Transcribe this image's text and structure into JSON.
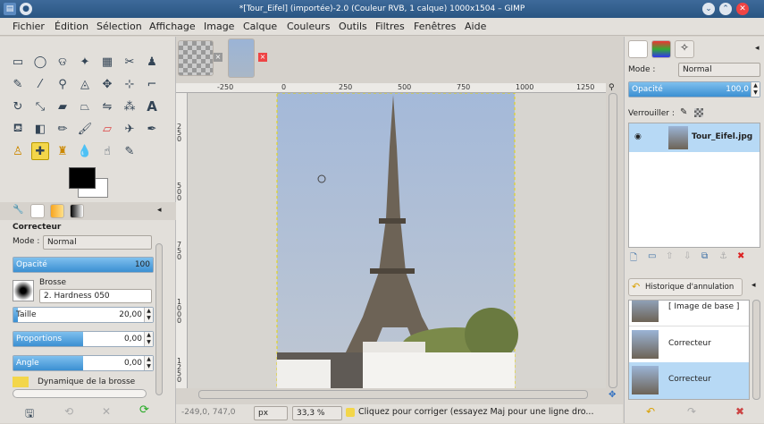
{
  "window": {
    "title": "*[Tour_Eifel] (importée)-2.0 (Couleur RVB, 1 calque) 1000x1504 – GIMP"
  },
  "menu": [
    "Fichier",
    "Édition",
    "Sélection",
    "Affichage",
    "Image",
    "Calque",
    "Couleurs",
    "Outils",
    "Filtres",
    "Fenêtres",
    "Aide"
  ],
  "toolbox": {
    "tools": [
      "rect-select",
      "ellipse-select",
      "free-select",
      "fuzzy-select",
      "color-select",
      "scissors",
      "foreground-select",
      "paths",
      "color-picker",
      "zoom",
      "measure",
      "move",
      "align",
      "crop",
      "rotate",
      "scale",
      "shear",
      "perspective",
      "flip",
      "text",
      "bucket-fill",
      "blend",
      "pencil",
      "paintbrush",
      "eraser",
      "airbrush",
      "ink",
      "clone",
      "heal",
      "perspective-clone",
      "blur",
      "smudge",
      "dodge-burn"
    ],
    "options_title": "Correcteur",
    "mode_label": "Mode :",
    "mode_value": "Normal",
    "opacity_label": "Opacité",
    "opacity_value": "100",
    "brush_label": "Brosse",
    "brush_value": "2. Hardness 050",
    "size_label": "Taille",
    "size_value": "20,00",
    "proportions_label": "Proportions",
    "proportions_value": "0,00",
    "angle_label": "Angle",
    "angle_value": "0,00",
    "dynamics_label": "Dynamique de la brosse"
  },
  "image": {
    "ruler_top": [
      "-250",
      "0",
      "250",
      "500",
      "750",
      "1000",
      "1250"
    ],
    "ruler_left": [
      "250",
      "500",
      "750",
      "1000",
      "1250"
    ]
  },
  "status": {
    "coords": "-249,0, 747,0",
    "unit": "px",
    "zoom": "33,3 %",
    "message": "Cliquez pour corriger (essayez Maj pour une ligne dro..."
  },
  "layers": {
    "mode_label": "Mode :",
    "mode_value": "Normal",
    "opacity_label": "Opacité",
    "opacity_value": "100,0",
    "lock_label": "Verrouiller :",
    "layer_name": "Tour_Eifel.jpg"
  },
  "history": {
    "title": "Historique d'annulation",
    "items": [
      "[ Image de base ]",
      "Correcteur",
      "Correcteur"
    ]
  },
  "colors": {
    "accent": "#3b8fd2",
    "titlebar": "#2a5582",
    "selected": "#b7d9f5"
  }
}
